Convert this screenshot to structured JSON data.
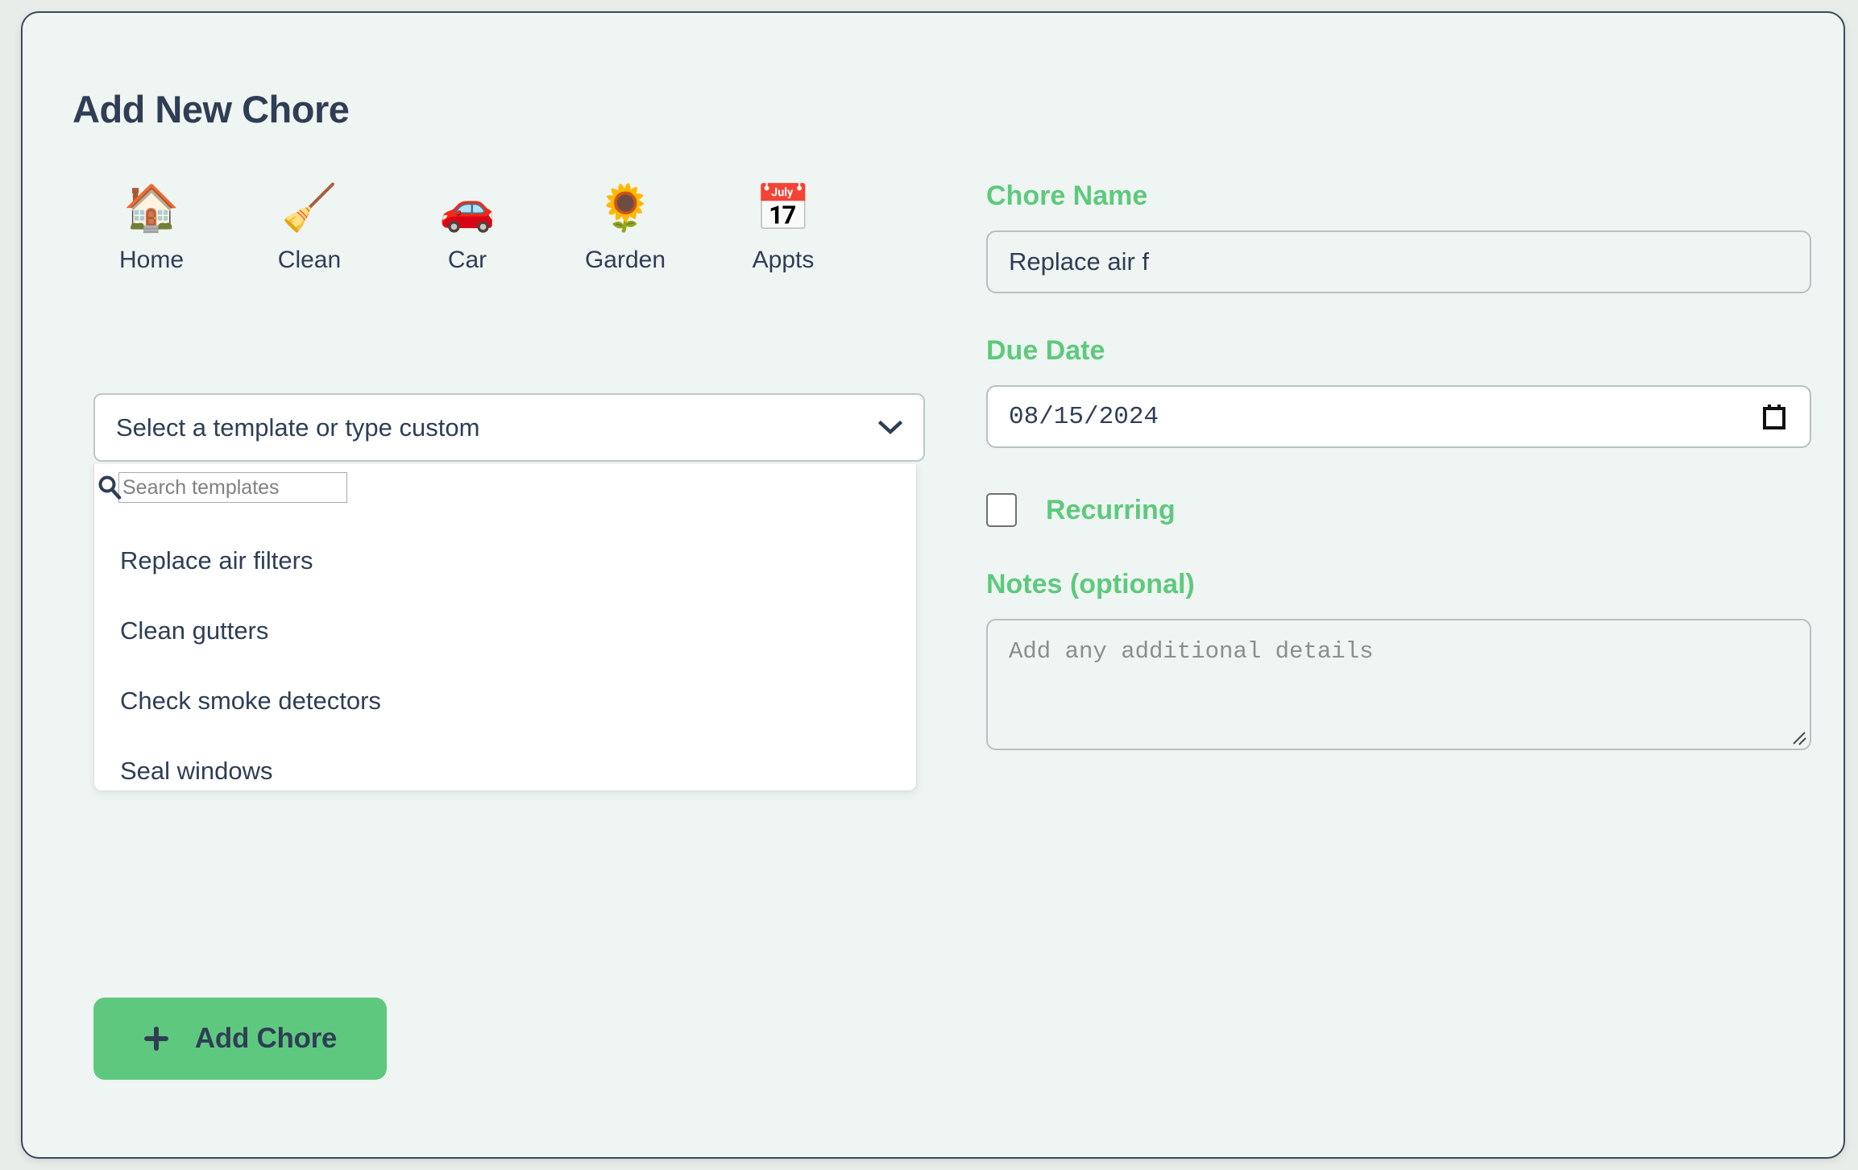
{
  "page": {
    "title": "Add New Chore"
  },
  "categories": [
    {
      "label": "Home",
      "icon": "house-icon",
      "emoji": "🏠"
    },
    {
      "label": "Clean",
      "icon": "broom-icon",
      "emoji": "🧹"
    },
    {
      "label": "Car",
      "icon": "car-icon",
      "emoji": "🚗"
    },
    {
      "label": "Garden",
      "icon": "sunflower-icon",
      "emoji": "🌻"
    },
    {
      "label": "Appts",
      "icon": "calendar-icon",
      "emoji": "📅"
    }
  ],
  "template_picker": {
    "selected_text": "Select a template or type custom",
    "chevron_icon": "chevron-down-icon",
    "search": {
      "icon": "search-icon",
      "value": "",
      "placeholder": "Search templates"
    },
    "options": [
      "Replace air filters",
      "Clean gutters",
      "Check smoke detectors",
      "Seal windows"
    ]
  },
  "form": {
    "chore_name": {
      "label": "Chore Name",
      "value": "Replace air f",
      "placeholder": ""
    },
    "due_date": {
      "label": "Due Date",
      "value": "08/15/2024",
      "picker_icon": "calendar-picker-icon"
    },
    "recurring": {
      "label": "Recurring",
      "checked": false
    },
    "notes": {
      "label": "Notes (optional)",
      "value": "",
      "placeholder": "Add any additional details"
    }
  },
  "submit": {
    "label": "Add Chore",
    "icon": "plus-icon"
  },
  "colors": {
    "accent_green": "#5ec97e",
    "text_dark": "#2f3e56",
    "card_bg": "#eff5f2",
    "border_gray": "#b9c0c4",
    "card_border": "#3d4a5c"
  }
}
